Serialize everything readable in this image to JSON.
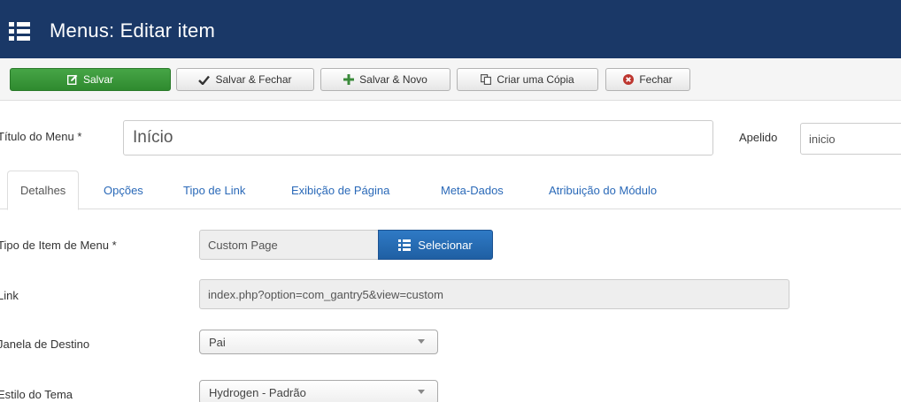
{
  "header": {
    "title": "Menus: Editar item",
    "icon": "list-icon"
  },
  "toolbar": {
    "save": "Salvar",
    "save_close": "Salvar & Fechar",
    "save_new": "Salvar & Novo",
    "save_copy": "Criar uma Cópia",
    "close": "Fechar"
  },
  "form": {
    "menu_title_label": "Título do Menu *",
    "menu_title_value": "Início",
    "alias_label": "Apelido",
    "alias_value": "inicio"
  },
  "tabs": [
    {
      "label": "Detalhes",
      "active": true
    },
    {
      "label": "Opções"
    },
    {
      "label": "Tipo de Link"
    },
    {
      "label": "Exibição de Página"
    },
    {
      "label": "Meta-Dados"
    },
    {
      "label": "Atribuição do Módulo"
    }
  ],
  "details": {
    "item_type_label": "Tipo de Item de Menu *",
    "item_type_value": "Custom Page",
    "select_button": "Selecionar",
    "link_label": "Link",
    "link_value": "index.php?option=com_gantry5&view=custom",
    "target_label": "Janela de Destino",
    "target_value": "Pai",
    "style_label": "Estilo do Tema",
    "style_value": "Hydrogen - Padrão"
  },
  "colors": {
    "header_bg": "#1a3867",
    "save_green": "#3f9c3f",
    "link_blue": "#2a69b8",
    "select_blue": "#2667b1"
  }
}
